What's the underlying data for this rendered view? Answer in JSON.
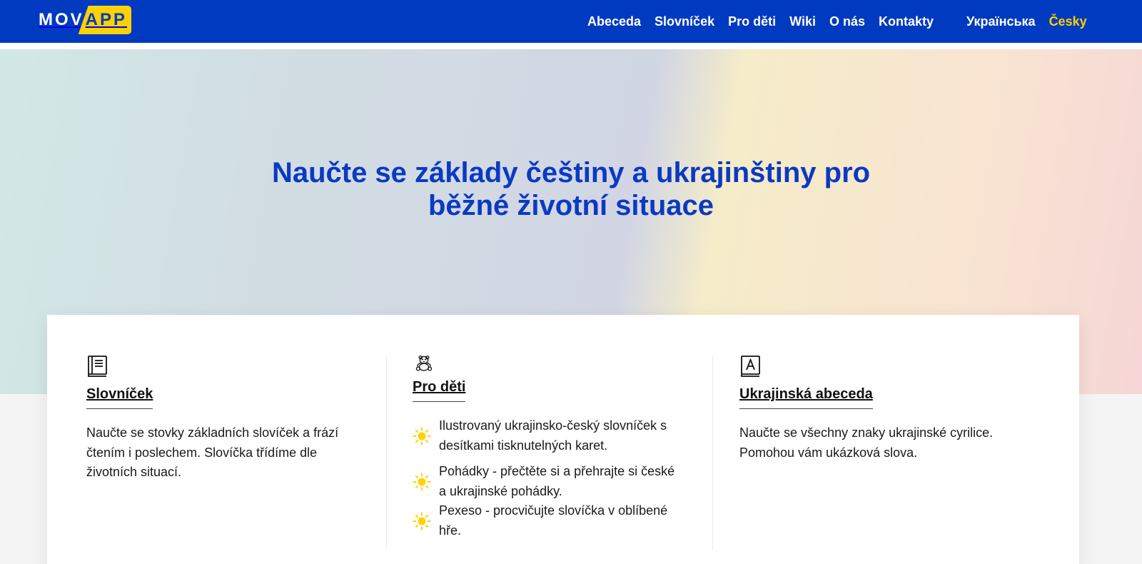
{
  "header": {
    "logo": {
      "part1": "MOV",
      "part2": "APP"
    },
    "nav": [
      {
        "label": "Abeceda"
      },
      {
        "label": "Slovníček"
      },
      {
        "label": "Pro děti"
      },
      {
        "label": "Wiki"
      },
      {
        "label": "O nás"
      },
      {
        "label": "Kontakty"
      }
    ],
    "languages": [
      {
        "label": "Українська",
        "active": false
      },
      {
        "label": "Česky",
        "active": true
      }
    ]
  },
  "hero": {
    "title_line1": "Naučte se základy češtiny a ukrajinštiny pro",
    "title_line2": "běžné životní situace"
  },
  "features": [
    {
      "icon": "book-icon",
      "title": "Slovníček",
      "text": "Naučte se stovky základních slovíček a frází čtením i poslechem. Slovíčka třídíme dle životních situací."
    },
    {
      "icon": "teddy-bear-icon",
      "title": "Pro děti",
      "items": [
        "Ilustrovaný ukrajinsko-český slovníček s desítkami tisknutelných karet.",
        "Pohádky - přečtěte si a přehrajte si české a ukrajinské pohádky.",
        "Pexeso - procvičujte slovíčka v oblíbené hře."
      ],
      "bullet_icon": "sun-icon"
    },
    {
      "icon": "alphabet-book-icon",
      "title": "Ukrajinská abeceda",
      "text": "Naučte se všechny znaky ukrajinské cyrilice. Pomohou vám ukázková slova."
    }
  ],
  "colors": {
    "brand_blue": "#003ac0",
    "brand_yellow": "#ffd200",
    "title_blue": "#0b3ac1"
  }
}
